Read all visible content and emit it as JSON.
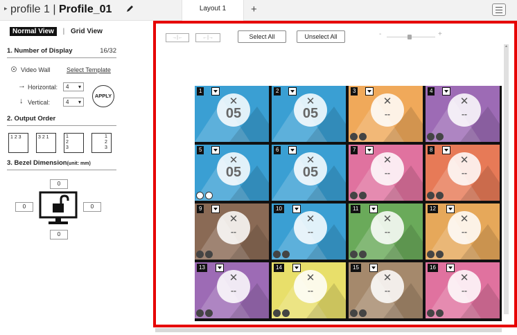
{
  "topbar": {
    "profile_prefix": "profile 1 |",
    "profile_name": "Profile_01",
    "tab_label": "Layout 1",
    "add_tab": "+"
  },
  "sidebar": {
    "normal_view": "Normal View",
    "separator": "|",
    "grid_view": "Grid View",
    "section1_title": "1.  Number of Display",
    "display_count": "16/32",
    "video_wall_label": "Video Wall",
    "select_template": "Select Template",
    "horizontal_label": "Horizontal:",
    "horizontal_value": "4",
    "vertical_label": "Vertical:",
    "vertical_value": "4",
    "apply": "APPLY",
    "section2_title": "2.  Output Order",
    "order_options": [
      "1 2 3",
      "3 2 1",
      "1 2 3",
      "1 2 3"
    ],
    "section3_title": "3.  Bezel Dimension",
    "section3_unit": "(unit: mm)",
    "bezel_top": "0",
    "bezel_left": "0",
    "bezel_right": "0",
    "bezel_bottom": "0"
  },
  "toolbar": {
    "select_all": "Select All",
    "unselect_all": "Unselect All",
    "zoom_minus": "-",
    "zoom_plus": "+"
  },
  "wall": {
    "cells": [
      {
        "num": "1",
        "value": "05",
        "color": "#3a9fd3"
      },
      {
        "num": "2",
        "value": "05",
        "color": "#3a9fd3"
      },
      {
        "num": "3",
        "value": "--",
        "color": "#f0a95a"
      },
      {
        "num": "4",
        "value": "--",
        "color": "#9d6bb5"
      },
      {
        "num": "5",
        "value": "05",
        "color": "#3a9fd3"
      },
      {
        "num": "6",
        "value": "05",
        "color": "#3a9fd3"
      },
      {
        "num": "7",
        "value": "--",
        "color": "#e0729f"
      },
      {
        "num": "8",
        "value": "--",
        "color": "#e77a57"
      },
      {
        "num": "9",
        "value": "--",
        "color": "#8a6a55"
      },
      {
        "num": "10",
        "value": "--",
        "color": "#3a9fd3"
      },
      {
        "num": "11",
        "value": "--",
        "color": "#6aaa5a"
      },
      {
        "num": "12",
        "value": "--",
        "color": "#e6a85a"
      },
      {
        "num": "13",
        "value": "--",
        "color": "#9d6bb5"
      },
      {
        "num": "14",
        "value": "--",
        "color": "#e8df6a"
      },
      {
        "num": "15",
        "value": "--",
        "color": "#a5896c"
      },
      {
        "num": "16",
        "value": "--",
        "color": "#e0729f"
      }
    ]
  }
}
